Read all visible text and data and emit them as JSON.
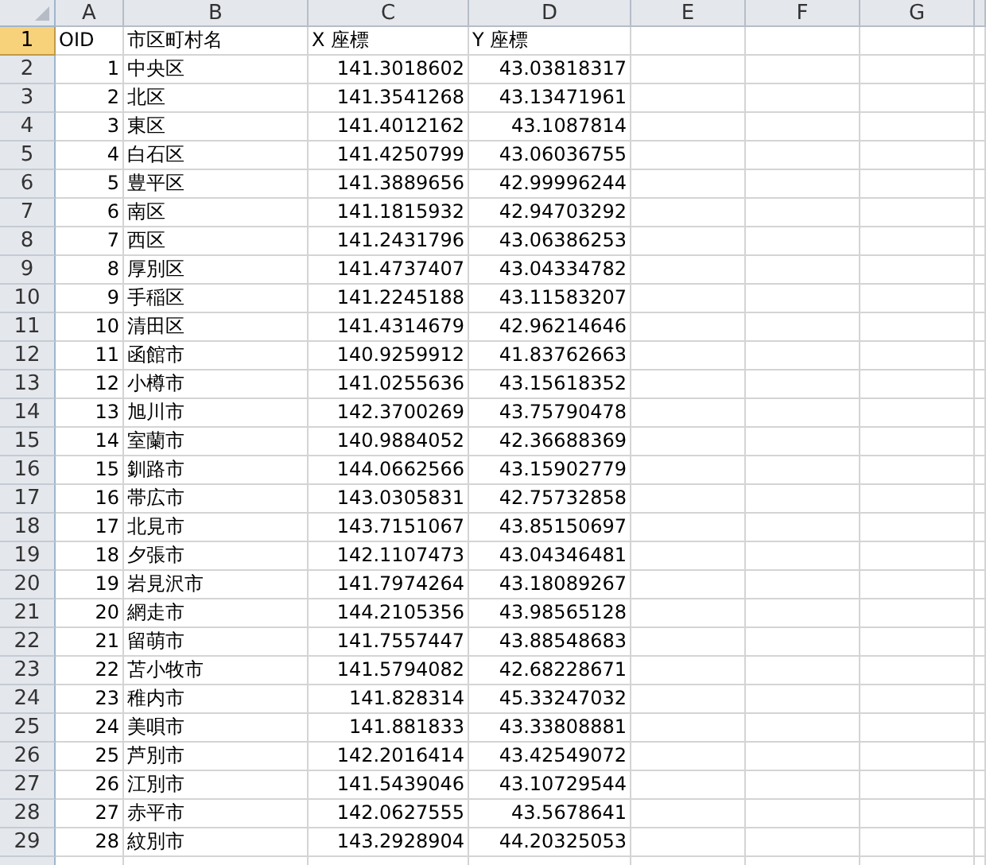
{
  "columns": [
    "A",
    "B",
    "C",
    "D",
    "E",
    "F",
    "G"
  ],
  "rows": [
    {
      "header": "1",
      "selected": true,
      "kind": "heading",
      "cells": [
        "OID",
        "市区町村名",
        "X 座標",
        "Y 座標"
      ]
    },
    {
      "header": "2",
      "selected": false,
      "kind": "data",
      "cells": [
        "1",
        "中央区",
        "141.3018602",
        "43.03818317"
      ]
    },
    {
      "header": "3",
      "selected": false,
      "kind": "data",
      "cells": [
        "2",
        "北区",
        "141.3541268",
        "43.13471961"
      ]
    },
    {
      "header": "4",
      "selected": false,
      "kind": "data",
      "cells": [
        "3",
        "東区",
        "141.4012162",
        "43.1087814"
      ]
    },
    {
      "header": "5",
      "selected": false,
      "kind": "data",
      "cells": [
        "4",
        "白石区",
        "141.4250799",
        "43.06036755"
      ]
    },
    {
      "header": "6",
      "selected": false,
      "kind": "data",
      "cells": [
        "5",
        "豊平区",
        "141.3889656",
        "42.99996244"
      ]
    },
    {
      "header": "7",
      "selected": false,
      "kind": "data",
      "cells": [
        "6",
        "南区",
        "141.1815932",
        "42.94703292"
      ]
    },
    {
      "header": "8",
      "selected": false,
      "kind": "data",
      "cells": [
        "7",
        "西区",
        "141.2431796",
        "43.06386253"
      ]
    },
    {
      "header": "9",
      "selected": false,
      "kind": "data",
      "cells": [
        "8",
        "厚別区",
        "141.4737407",
        "43.04334782"
      ]
    },
    {
      "header": "10",
      "selected": false,
      "kind": "data",
      "cells": [
        "9",
        "手稲区",
        "141.2245188",
        "43.11583207"
      ]
    },
    {
      "header": "11",
      "selected": false,
      "kind": "data",
      "cells": [
        "10",
        "清田区",
        "141.4314679",
        "42.96214646"
      ]
    },
    {
      "header": "12",
      "selected": false,
      "kind": "data",
      "cells": [
        "11",
        "函館市",
        "140.9259912",
        "41.83762663"
      ]
    },
    {
      "header": "13",
      "selected": false,
      "kind": "data",
      "cells": [
        "12",
        "小樽市",
        "141.0255636",
        "43.15618352"
      ]
    },
    {
      "header": "14",
      "selected": false,
      "kind": "data",
      "cells": [
        "13",
        "旭川市",
        "142.3700269",
        "43.75790478"
      ]
    },
    {
      "header": "15",
      "selected": false,
      "kind": "data",
      "cells": [
        "14",
        "室蘭市",
        "140.9884052",
        "42.36688369"
      ]
    },
    {
      "header": "16",
      "selected": false,
      "kind": "data",
      "cells": [
        "15",
        "釧路市",
        "144.0662566",
        "43.15902779"
      ]
    },
    {
      "header": "17",
      "selected": false,
      "kind": "data",
      "cells": [
        "16",
        "帯広市",
        "143.0305831",
        "42.75732858"
      ]
    },
    {
      "header": "18",
      "selected": false,
      "kind": "data",
      "cells": [
        "17",
        "北見市",
        "143.7151067",
        "43.85150697"
      ]
    },
    {
      "header": "19",
      "selected": false,
      "kind": "data",
      "cells": [
        "18",
        "夕張市",
        "142.1107473",
        "43.04346481"
      ]
    },
    {
      "header": "20",
      "selected": false,
      "kind": "data",
      "cells": [
        "19",
        "岩見沢市",
        "141.7974264",
        "43.18089267"
      ]
    },
    {
      "header": "21",
      "selected": false,
      "kind": "data",
      "cells": [
        "20",
        "網走市",
        "144.2105356",
        "43.98565128"
      ]
    },
    {
      "header": "22",
      "selected": false,
      "kind": "data",
      "cells": [
        "21",
        "留萌市",
        "141.7557447",
        "43.88548683"
      ]
    },
    {
      "header": "23",
      "selected": false,
      "kind": "data",
      "cells": [
        "22",
        "苫小牧市",
        "141.5794082",
        "42.68228671"
      ]
    },
    {
      "header": "24",
      "selected": false,
      "kind": "data",
      "cells": [
        "23",
        "稚内市",
        "141.828314",
        "45.33247032"
      ]
    },
    {
      "header": "25",
      "selected": false,
      "kind": "data",
      "cells": [
        "24",
        "美唄市",
        "141.881833",
        "43.33808881"
      ]
    },
    {
      "header": "26",
      "selected": false,
      "kind": "data",
      "cells": [
        "25",
        "芦別市",
        "142.2016414",
        "43.42549072"
      ]
    },
    {
      "header": "27",
      "selected": false,
      "kind": "data",
      "cells": [
        "26",
        "江別市",
        "141.5439046",
        "43.10729544"
      ]
    },
    {
      "header": "28",
      "selected": false,
      "kind": "data",
      "cells": [
        "27",
        "赤平市",
        "142.0627555",
        "43.5678641"
      ]
    },
    {
      "header": "29",
      "selected": false,
      "kind": "data",
      "cells": [
        "28",
        "紋別市",
        "143.2928904",
        "44.20325053"
      ]
    }
  ]
}
